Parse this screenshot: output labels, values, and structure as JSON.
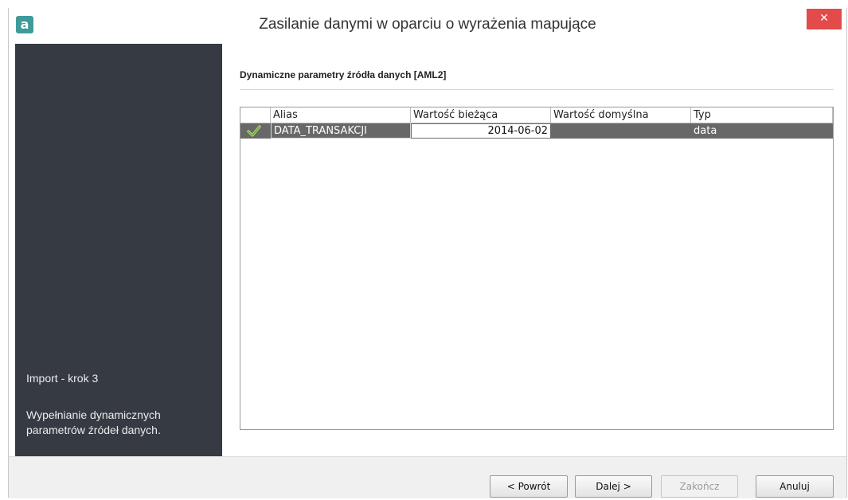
{
  "window": {
    "title": "Zasilanie danymi w oparciu o wyrażenia mapujące",
    "app_icon": "a",
    "close_label": "✕"
  },
  "sidebar": {
    "step_title": "Import - krok 3",
    "step_description": "Wypełnianie dynamicznych parametrów źródeł danych."
  },
  "main": {
    "section_title": "Dynamiczne parametry źródła danych [AML2]",
    "grid": {
      "columns": [
        "",
        "Alias",
        "Wartość bieżąca",
        "Wartość domyślna",
        "Typ"
      ],
      "rows": [
        {
          "status_icon": "checkmark-icon",
          "alias": "DATA_TRANSAKCJI",
          "current_value": "2014-06-02",
          "default_value": "",
          "type": "data"
        }
      ]
    }
  },
  "footer": {
    "back_label": "< Powrót",
    "next_label": "Dalej >",
    "finish_label": "Zakończ",
    "cancel_label": "Anuluj"
  },
  "colors": {
    "sidebar_bg": "#363a43",
    "close_button": "#e34a4a",
    "selected_row": "#686868",
    "app_icon": "#3f9b99"
  }
}
